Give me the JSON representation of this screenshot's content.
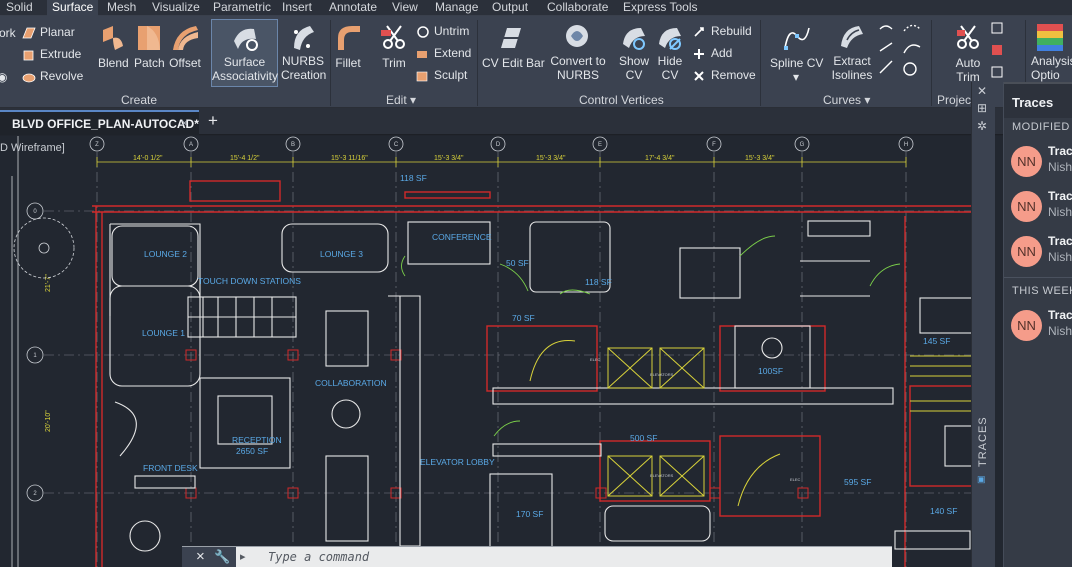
{
  "menubar": {
    "items": [
      "Solid",
      "Surface",
      "Mesh",
      "Visualize",
      "Parametric",
      "Insert",
      "Annotate",
      "View",
      "Manage",
      "Output",
      "Collaborate",
      "Express Tools"
    ],
    "active": "Surface"
  },
  "ribbon": {
    "network": {
      "cut_label": "ork"
    },
    "create": {
      "planar": "Planar",
      "extrude": "Extrude",
      "revolve": "Revolve",
      "blend": "Blend",
      "patch": "Patch",
      "offset": "Offset",
      "surface_assoc_l1": "Surface",
      "surface_assoc_l2": "Associativity",
      "nurbs_l1": "NURBS",
      "nurbs_l2": "Creation",
      "group": "Create"
    },
    "edit": {
      "fillet": "Fillet",
      "trim": "Trim",
      "untrim": "Untrim",
      "extend": "Extend",
      "sculpt": "Sculpt",
      "group": "Edit"
    },
    "control_vertices": {
      "cv_edit_bar": "CV Edit Bar",
      "convert_l1": "Convert to",
      "convert_l2": "NURBS",
      "show_cv_l1": "Show",
      "show_cv_l2": "CV",
      "hide_cv_l1": "Hide",
      "hide_cv_l2": "CV",
      "rebuild": "Rebuild",
      "add": "Add",
      "remove": "Remove",
      "group": "Control Vertices"
    },
    "curves": {
      "spline_cv": "Spline CV",
      "extract_l1": "Extract",
      "extract_l2": "Isolines",
      "group": "Curves"
    },
    "project": {
      "auto_l1": "Auto",
      "auto_l2": "Trim",
      "group": "Project"
    },
    "analysis": {
      "label_l1": "Analysis",
      "label_l2": "Optio"
    }
  },
  "document": {
    "tab": "BLVD OFFICE_PLAN-AUTOCAD*",
    "close": "×",
    "new_tab": "+"
  },
  "viewport": {
    "label": "D Wireframe]"
  },
  "drawing": {
    "column_bubbles": [
      "Z",
      "A",
      "B",
      "C",
      "D",
      "E",
      "F",
      "G",
      "H"
    ],
    "row_bubbles": [
      "0",
      "1",
      "2"
    ],
    "dims_top": [
      "14'-0 1/2\"",
      "15'-4 1/2\"",
      "15'-3 11/16\"",
      "15'-3 3/4\"",
      "15'-3 3/4\"",
      "17'-4 3/4\"",
      "15'-3 3/4\""
    ],
    "dims_left": [
      "21'-7\"",
      "20'-10\""
    ],
    "rooms": [
      "LOUNGE 2",
      "LOUNGE 3",
      "CONFERENCE",
      "TOUCH DOWN STATIONS",
      "LOUNGE 1",
      "COLLABORATION",
      "RECEPTION",
      "2650 SF",
      "FRONT DESK",
      "ELEVATOR LOBBY",
      "118 SF",
      "50 SF",
      "118 SF",
      "70 SF",
      "100SF",
      "145 SF",
      "500 SF",
      "595 SF",
      "140 SF",
      "170 SF"
    ],
    "small_labels": [
      "ELEVATORS",
      "ELEVATORS",
      "ELEC",
      "ELEC"
    ]
  },
  "command": {
    "placeholder": "Type a command",
    "close": "×",
    "settings": "🔧",
    "prompt": "▸"
  },
  "traces": {
    "tab_label": "TRACES",
    "panel_title": "Traces",
    "section_modified": "MODIFIED T",
    "section_week": "THIS WEEK",
    "items": [
      {
        "initials": "NN",
        "name": "Trace",
        "sub": "Nish"
      },
      {
        "initials": "NN",
        "name": "Trace",
        "sub": "Nish"
      },
      {
        "initials": "NN",
        "name": "Trace",
        "sub": "Nish"
      },
      {
        "initials": "NN",
        "name": "Trace",
        "sub": "Nish"
      }
    ]
  },
  "colors": {
    "ribbon_bg": "#3b4250",
    "canvas_bg": "#222730",
    "wall_red": "#d12a2a",
    "line_yellow": "#d8d23a",
    "dim_green": "#7bcf4a",
    "room_label": "#5aa9e6",
    "white_line": "#e8e8e8",
    "avatar": "#f59c8a"
  }
}
